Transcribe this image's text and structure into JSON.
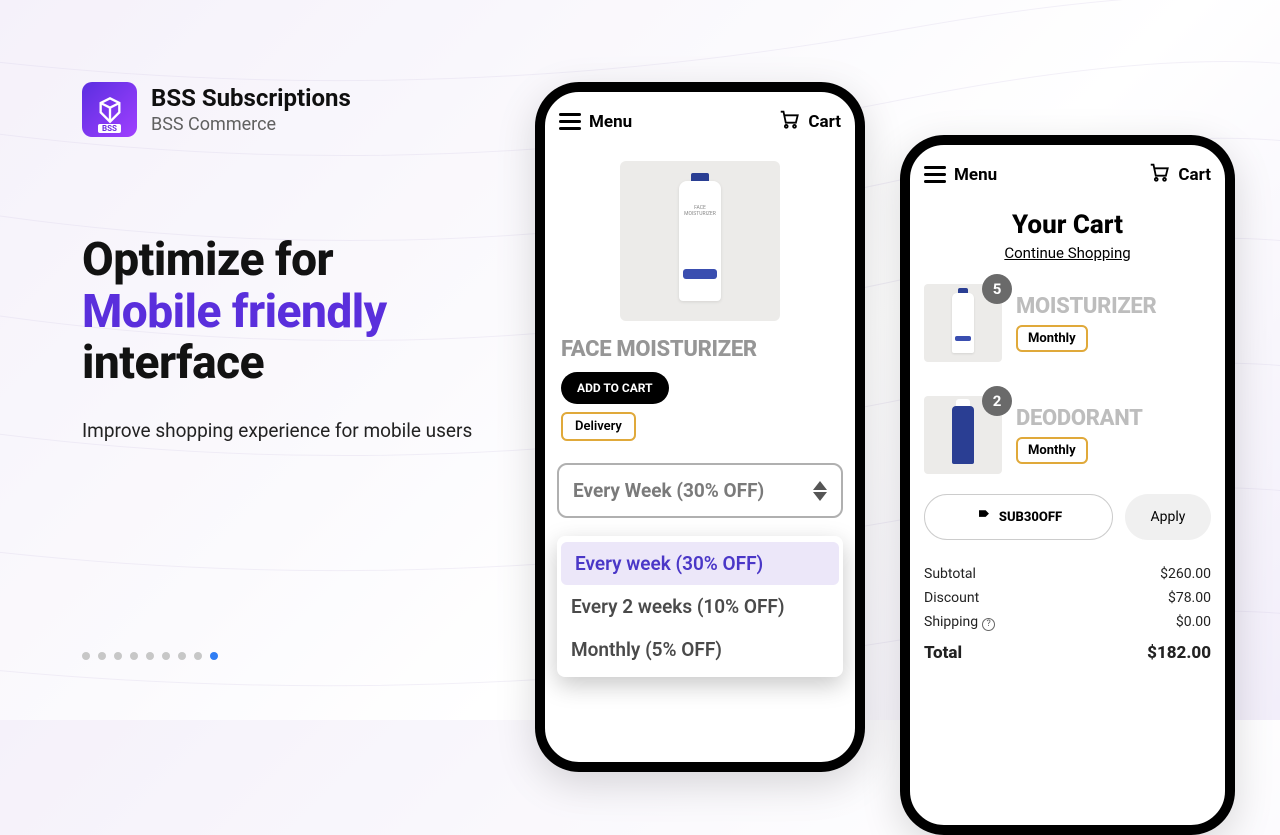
{
  "brand": {
    "title": "BSS Subscriptions",
    "subtitle": "BSS Commerce",
    "icon_tag": "BSS"
  },
  "headline": {
    "line1": "Optimize for",
    "accent": "Mobile friendly",
    "line3": "interface"
  },
  "tagline": "Improve shopping experience for mobile users",
  "carousel": {
    "count": 9,
    "active_index": 8
  },
  "phone_common": {
    "menu_label": "Menu",
    "cart_label": "Cart"
  },
  "phone1": {
    "product_name": "FACE MOISTURIZER",
    "product_image_label": "FACE MOISTURIZER",
    "add_to_cart": "ADD TO CART",
    "delivery_chip": "Delivery",
    "frequency_selected": "Every Week (30% OFF)",
    "frequency_options": [
      "Every week (30% OFF)",
      "Every 2 weeks (10% OFF)",
      "Monthly (5% OFF)"
    ],
    "frequency_selected_index": 0
  },
  "phone2": {
    "cart_title": "Your Cart",
    "continue_label": "Continue Shopping",
    "items": [
      {
        "name": "MOISTURIZER",
        "qty": "5",
        "frequency": "Monthly"
      },
      {
        "name": "DEODORANT",
        "qty": "2",
        "frequency": "Monthly"
      }
    ],
    "promo_code": "SUB30OFF",
    "apply_label": "Apply",
    "totals": {
      "subtotal_label": "Subtotal",
      "subtotal": "$260.00",
      "discount_label": "Discount",
      "discount": "$78.00",
      "shipping_label": "Shipping",
      "shipping": "$0.00",
      "total_label": "Total",
      "total": "$182.00"
    }
  }
}
